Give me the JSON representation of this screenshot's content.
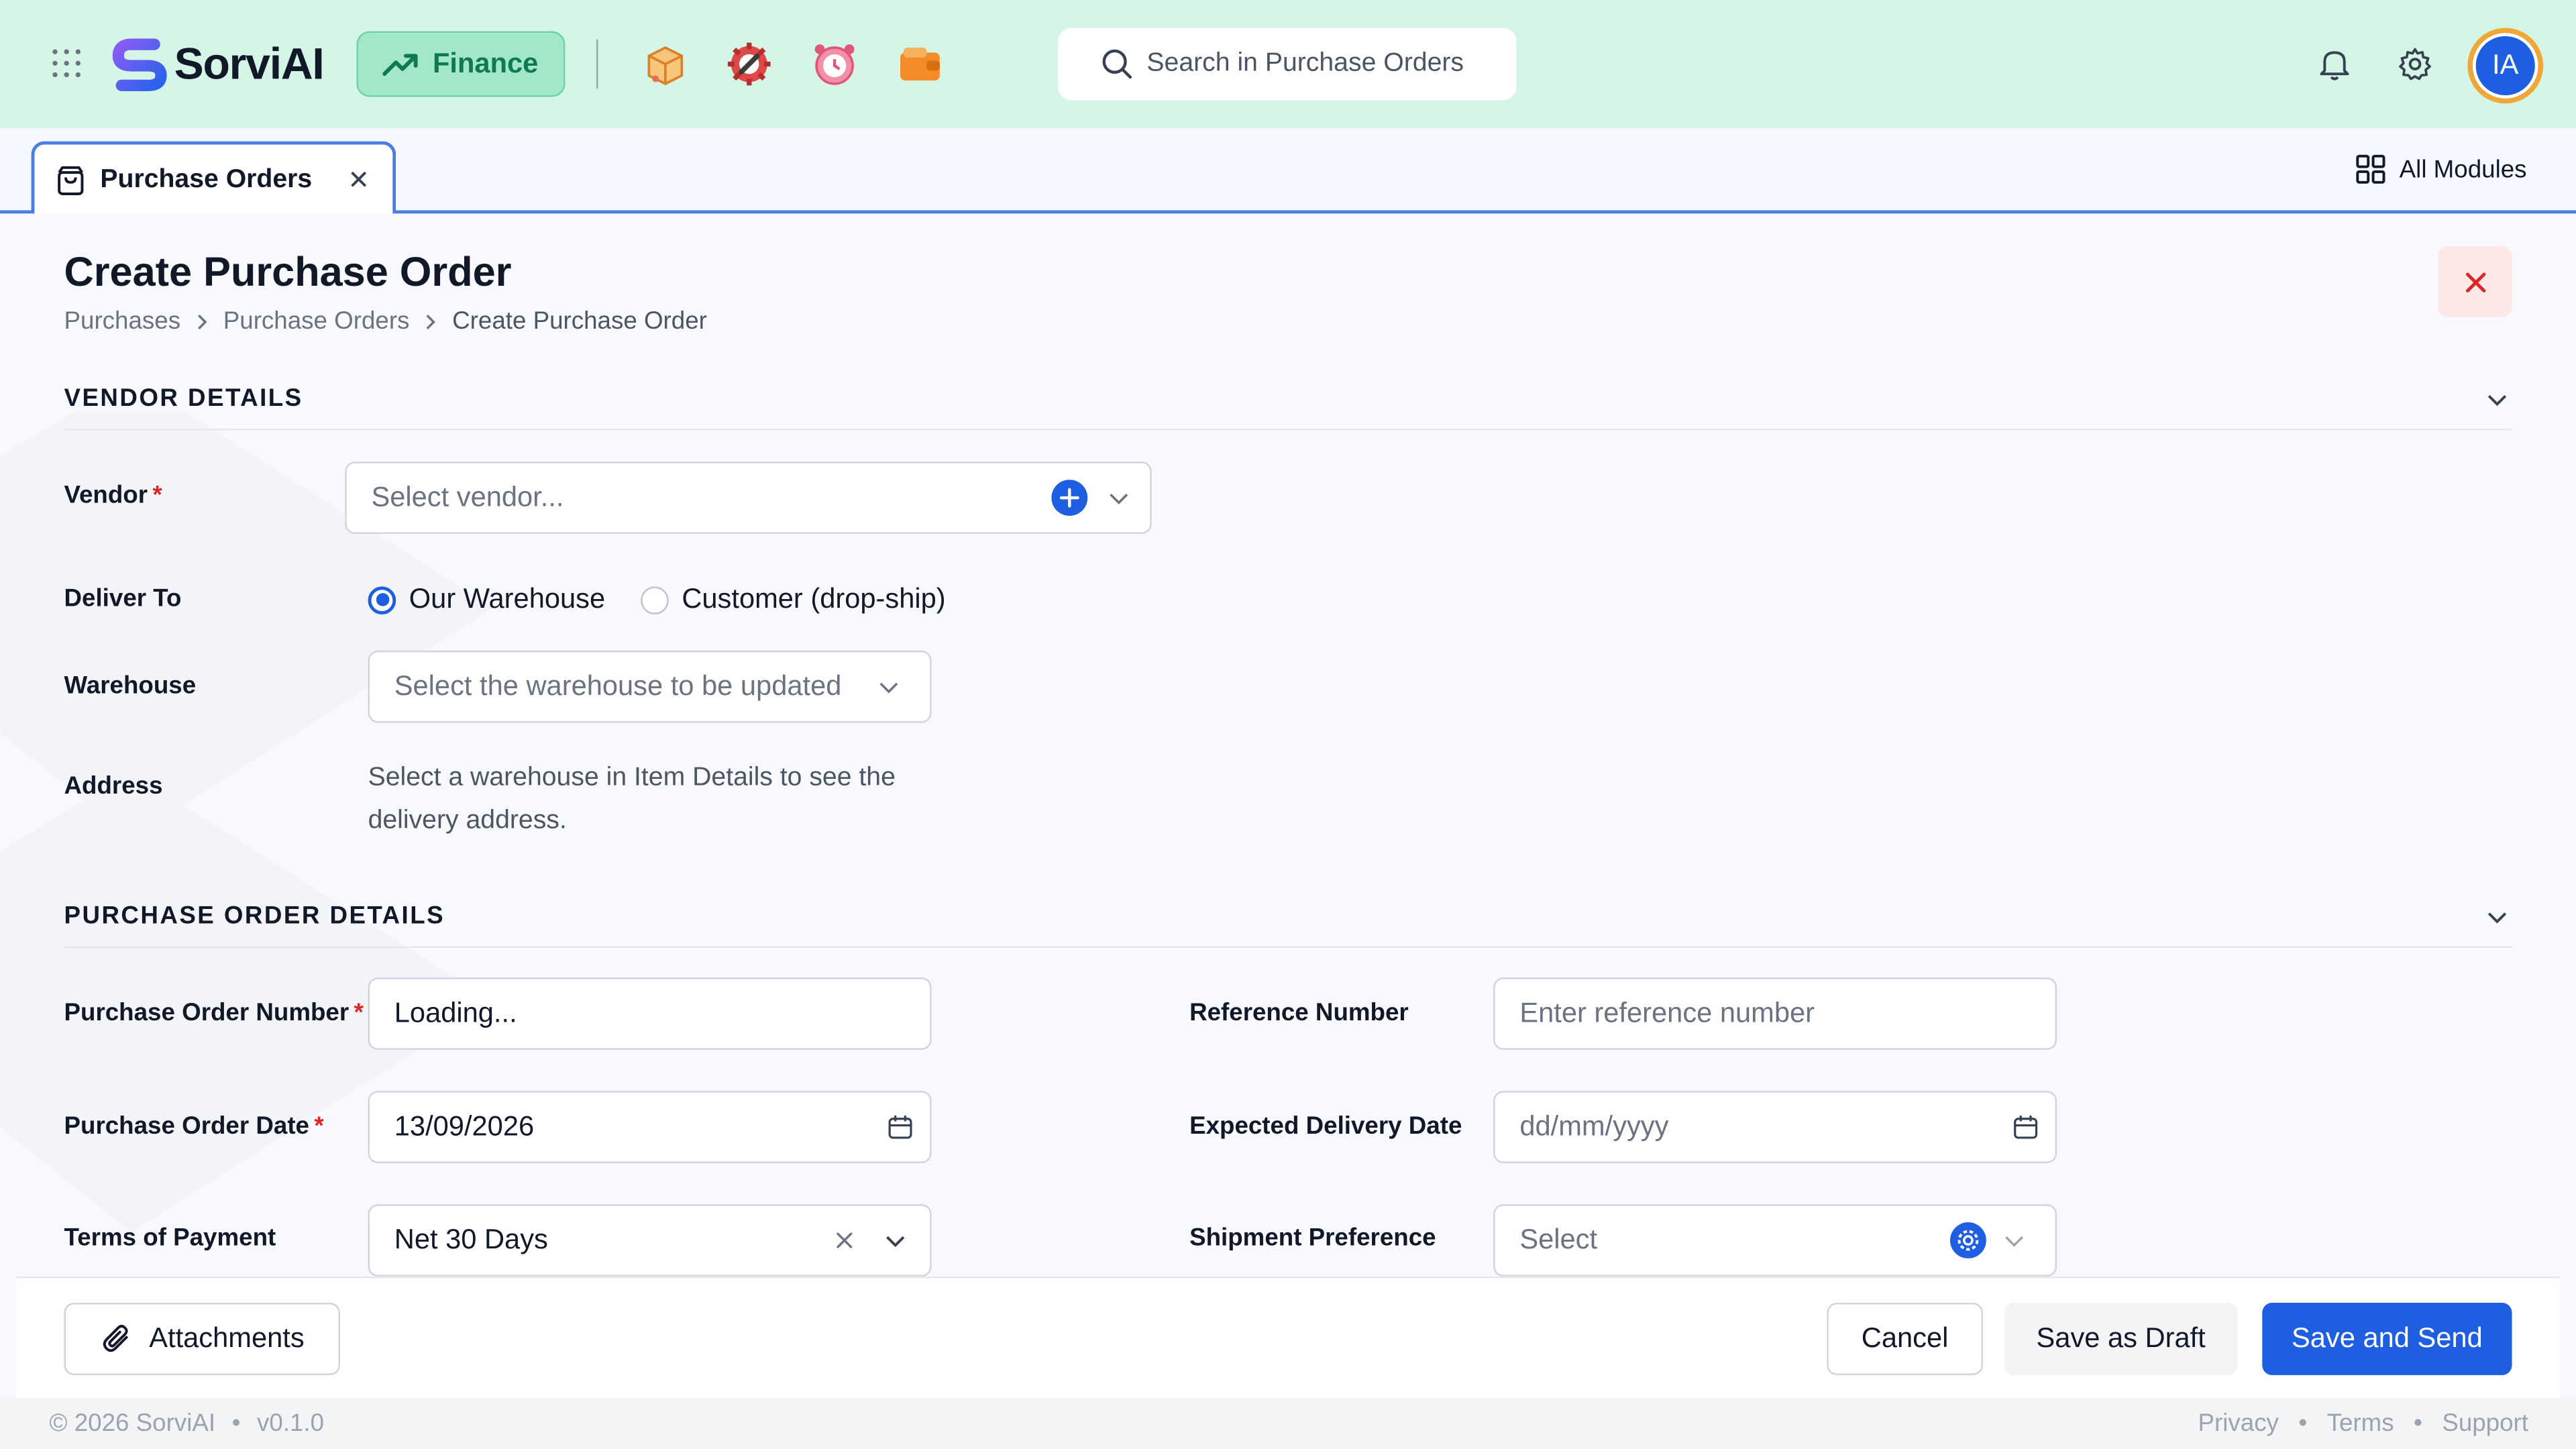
{
  "header": {
    "logo_text": "SorviAI",
    "module_label": "Finance",
    "search_placeholder": "Search in Purchase Orders",
    "avatar_initials": "IA",
    "app_icons": [
      "shipping-box-icon",
      "gear-wrench-icon",
      "alarm-clock-icon",
      "wallet-icon"
    ]
  },
  "tabs": {
    "active_label": "Purchase Orders",
    "all_modules_label": "All Modules"
  },
  "page": {
    "title": "Create Purchase Order",
    "breadcrumb": [
      "Purchases",
      "Purchase Orders",
      "Create Purchase Order"
    ]
  },
  "vendor_section": {
    "title": "VENDOR DETAILS",
    "vendor_label": "Vendor",
    "vendor_placeholder": "Select vendor...",
    "deliver_to_label": "Deliver To",
    "deliver_options": [
      "Our Warehouse",
      "Customer (drop-ship)"
    ],
    "deliver_selected": "Our Warehouse",
    "warehouse_label": "Warehouse",
    "warehouse_placeholder": "Select the warehouse to be updated",
    "address_label": "Address",
    "address_text": "Select a warehouse in Item Details to see the delivery address."
  },
  "po_section": {
    "title": "PURCHASE ORDER DETAILS",
    "po_number_label": "Purchase Order Number",
    "po_number_value": "Loading...",
    "reference_label": "Reference Number",
    "reference_placeholder": "Enter reference number",
    "po_date_label": "Purchase Order Date",
    "po_date_value": "13/09/2026",
    "expected_label": "Expected Delivery Date",
    "expected_placeholder": "dd/mm/yyyy",
    "terms_label": "Terms of Payment",
    "terms_value": "Net 30 Days",
    "shipment_label": "Shipment Preference",
    "shipment_placeholder": "Select"
  },
  "actions": {
    "attachments": "Attachments",
    "cancel": "Cancel",
    "save_draft": "Save as Draft",
    "save_send": "Save and Send"
  },
  "footer": {
    "copyright": "© 2026 SorviAI",
    "version": "v0.1.0",
    "links": [
      "Privacy",
      "Terms",
      "Support"
    ]
  },
  "colors": {
    "topbar": "#d5f6e6",
    "primary": "#1d5fe0",
    "finance": "#a3e7c9",
    "required": "#dc2626"
  }
}
